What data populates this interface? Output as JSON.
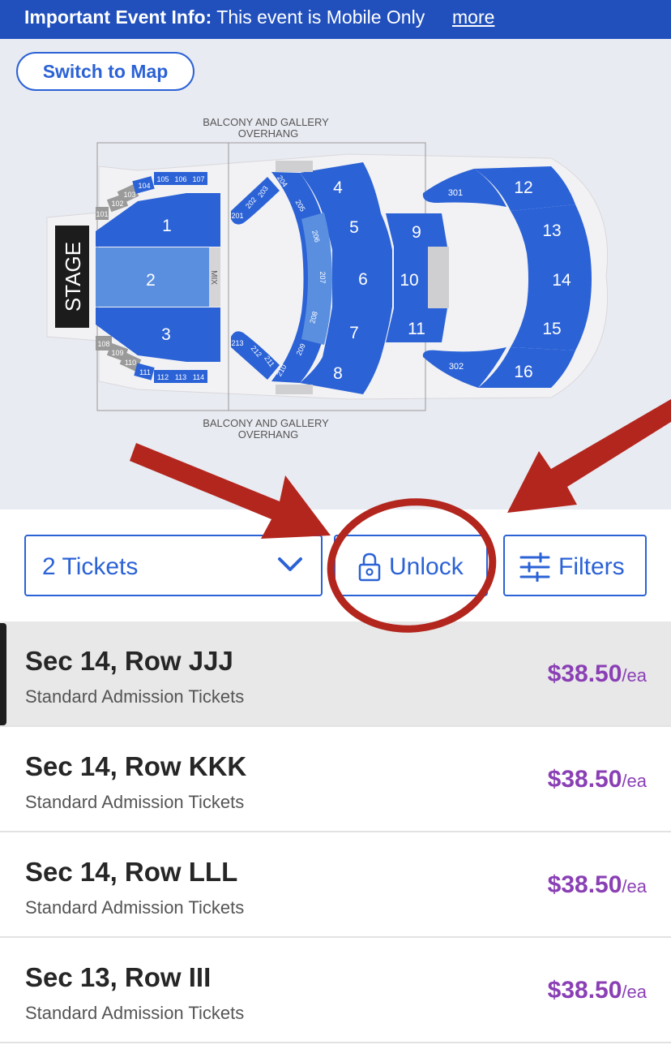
{
  "banner": {
    "label": "Important Event Info:",
    "text": "This event is Mobile Only",
    "more": "more"
  },
  "map": {
    "switch_label": "Switch to Map",
    "stage_label": "STAGE",
    "mix_label": "MIX",
    "overhang_top_1": "BALCONY AND GALLERY",
    "overhang_top_2": "OVERHANG",
    "overhang_bottom_1": "BALCONY AND GALLERY",
    "overhang_bottom_2": "OVERHANG",
    "sections": [
      "1",
      "2",
      "3",
      "4",
      "5",
      "6",
      "7",
      "8",
      "9",
      "10",
      "11",
      "12",
      "13",
      "14",
      "15",
      "16"
    ],
    "small_sections": [
      "101",
      "102",
      "103",
      "104",
      "105",
      "106",
      "107",
      "108",
      "109",
      "110",
      "111",
      "112",
      "113",
      "114",
      "201",
      "202",
      "203",
      "204",
      "205",
      "206",
      "207",
      "208",
      "209",
      "210",
      "211",
      "212",
      "213",
      "301",
      "302"
    ]
  },
  "controls": {
    "tickets_label": "2 Tickets",
    "unlock_label": "Unlock",
    "filters_label": "Filters"
  },
  "listings": [
    {
      "title": "Sec 14, Row JJJ",
      "subtitle": "Standard Admission Tickets",
      "price": "$38.50",
      "unit": "/ea"
    },
    {
      "title": "Sec 14, Row KKK",
      "subtitle": "Standard Admission Tickets",
      "price": "$38.50",
      "unit": "/ea"
    },
    {
      "title": "Sec 14, Row LLL",
      "subtitle": "Standard Admission Tickets",
      "price": "$38.50",
      "unit": "/ea"
    },
    {
      "title": "Sec 13, Row III",
      "subtitle": "Standard Admission Tickets",
      "price": "$38.50",
      "unit": "/ea"
    }
  ],
  "colors": {
    "brand_blue": "#2150bd",
    "section_blue": "#2b62d6",
    "price_purple": "#8a3fb5",
    "annotation_red": "#b3261e"
  }
}
